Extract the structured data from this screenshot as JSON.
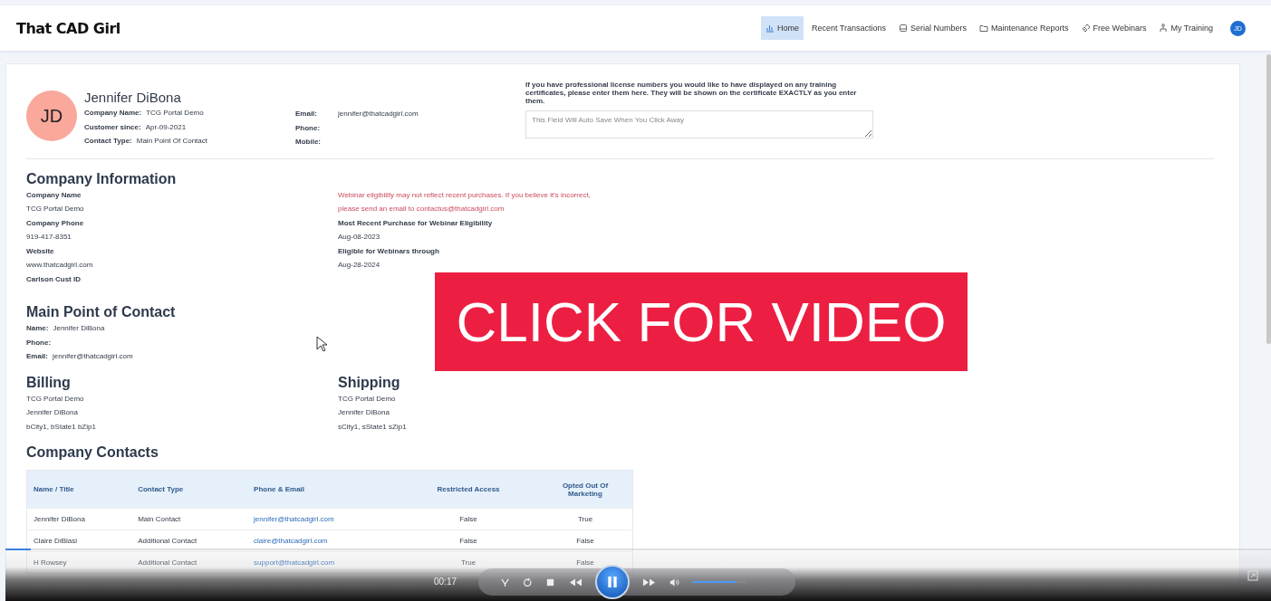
{
  "header": {
    "logo": "That CAD Girl",
    "nav": [
      {
        "label": "Home",
        "selected": true
      },
      {
        "label": "Recent Transactions",
        "selected": false
      },
      {
        "label": "Serial Numbers",
        "selected": false
      },
      {
        "label": "Maintenance Reports",
        "selected": false
      },
      {
        "label": "Free Webinars",
        "selected": false
      },
      {
        "label": "My Training",
        "selected": false
      }
    ],
    "user_initials": "JD"
  },
  "profile": {
    "initials": "JD",
    "name": "Jennifer DiBona",
    "fields": [
      {
        "label": "Company Name:",
        "value": "TCG Portal Demo"
      },
      {
        "label": "Customer since:",
        "value": "Apr-09-2021"
      },
      {
        "label": "Contact Type:",
        "value": "Main Point Of Contact"
      }
    ],
    "contact_fields": [
      {
        "label": "Email:",
        "value": "jennifer@thatcadgirl.com"
      },
      {
        "label": "Phone:"
      },
      {
        "label": "Mobile:"
      }
    ],
    "license_note": "If you have professional license numbers you would like to have displayed on any training certificates, please enter them here. They will be shown on the certificate EXACTLY as you enter them.",
    "license_field": {
      "placeholder": "This Field Will Auto Save When You Click Away"
    }
  },
  "company_information": {
    "title": "Company Information",
    "fields": [
      {
        "label": "Company Name",
        "value": "TCG Portal Demo"
      },
      {
        "label": "Company Phone",
        "value": "919-417-8351"
      },
      {
        "label": "Website",
        "value": "www.thatcadgirl.com"
      },
      {
        "label": "Carlson Cust ID"
      }
    ],
    "warning": [
      "Webinar eligibility may not reflect recent purchases. If you believe it's incorrect,",
      "please send an email to contactus@thatcadgirl.com"
    ],
    "webinar_fields": [
      {
        "label": "Most Recent Purchase for Webinar Eligibility",
        "value": "Aug-08-2023"
      },
      {
        "label": "Eligible for Webinars through",
        "value": "Aug-28-2024"
      }
    ]
  },
  "main_point_of_contact": {
    "title": "Main Point of Contact",
    "fields": [
      {
        "label": "Name:",
        "value": "Jennifer DiBona"
      },
      {
        "label": "Phone:"
      },
      {
        "label": "Email:",
        "value": "jennifer@thatcadgirl.com"
      }
    ]
  },
  "addresses": [
    {
      "title": "Billing",
      "lines": [
        "TCG Portal Demo",
        "Jennifer DiBona",
        "bCity1, bState1 bZip1"
      ]
    },
    {
      "title": "Shipping",
      "lines": [
        "TCG Portal Demo",
        "Jennifer DiBona",
        "sCity1, sState1 sZip1"
      ]
    }
  ],
  "company_contacts": {
    "title": "Company Contacts",
    "columns": [
      "Name / Title",
      "Contact Type",
      "Phone & Email",
      "Restricted Access",
      "Opted Out Of Marketing"
    ],
    "rows": [
      [
        "Jennifer DiBona",
        "Main Contact",
        "jennifer@thatcadgirl.com",
        "False",
        "True"
      ],
      [
        "Claire DiBlasi",
        "Additional Contact",
        "claire@thatcadgirl.com",
        "False",
        "False"
      ],
      [
        "H Rowsey",
        "Additional Contact",
        "support@thatcadgirl.com",
        "True",
        "False"
      ]
    ]
  },
  "video_banner": "CLICK FOR VIDEO",
  "player": {
    "time": "00:17",
    "playing": true,
    "progress": {
      "level": 0.02
    },
    "volume": {
      "level": 0.82
    }
  }
}
